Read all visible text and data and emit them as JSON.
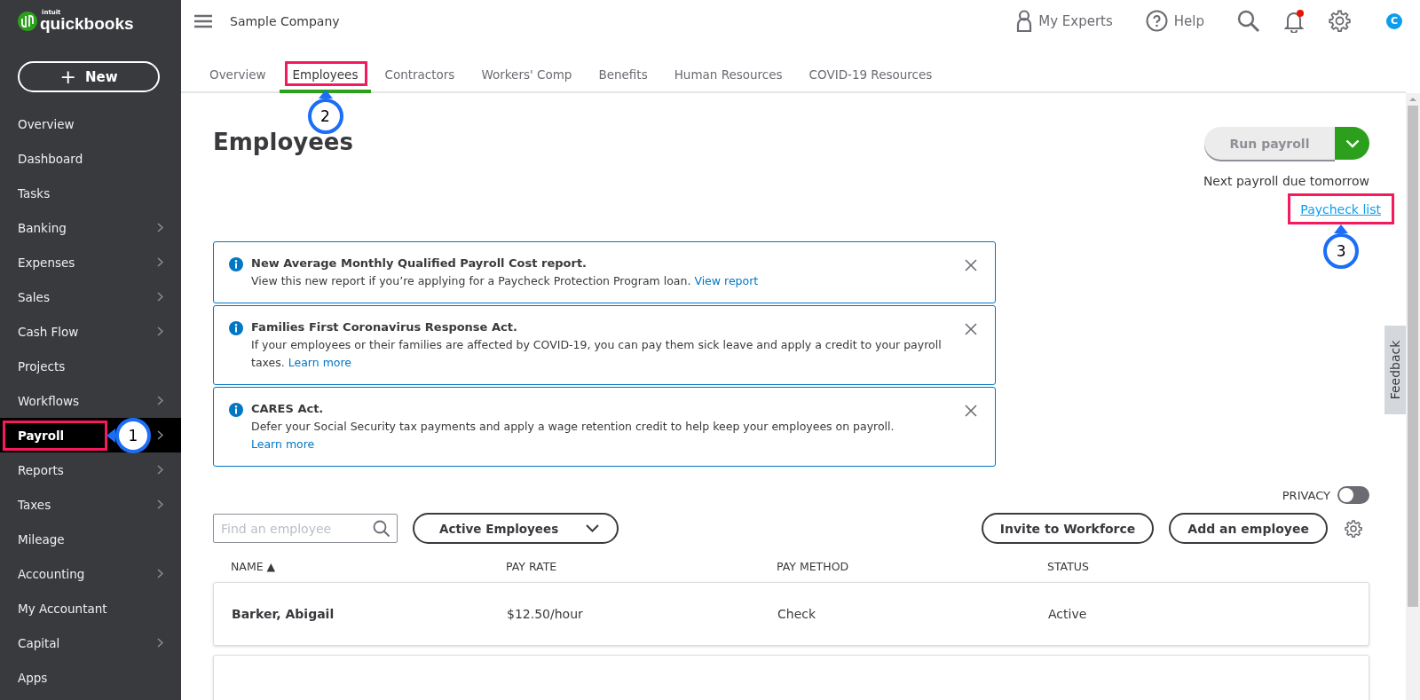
{
  "brand": {
    "maker": "intuit",
    "name": "quickbooks"
  },
  "new_button": {
    "icon": "+",
    "label": "New"
  },
  "sidebar": {
    "items": [
      {
        "label": "Overview",
        "submenu": false,
        "selected": false
      },
      {
        "label": "Dashboard",
        "submenu": false,
        "selected": false
      },
      {
        "label": "Tasks",
        "submenu": false,
        "selected": false
      },
      {
        "label": "Banking",
        "submenu": true,
        "selected": false
      },
      {
        "label": "Expenses",
        "submenu": true,
        "selected": false
      },
      {
        "label": "Sales",
        "submenu": true,
        "selected": false
      },
      {
        "label": "Cash Flow",
        "submenu": true,
        "selected": false
      },
      {
        "label": "Projects",
        "submenu": false,
        "selected": false
      },
      {
        "label": "Workflows",
        "submenu": true,
        "selected": false
      },
      {
        "label": "Payroll",
        "submenu": true,
        "selected": true,
        "callout": "1"
      },
      {
        "label": "Reports",
        "submenu": true,
        "selected": false
      },
      {
        "label": "Taxes",
        "submenu": true,
        "selected": false
      },
      {
        "label": "Mileage",
        "submenu": false,
        "selected": false
      },
      {
        "label": "Accounting",
        "submenu": true,
        "selected": false
      },
      {
        "label": "My Accountant",
        "submenu": false,
        "selected": false
      },
      {
        "label": "Capital",
        "submenu": true,
        "selected": false
      },
      {
        "label": "Apps",
        "submenu": false,
        "selected": false
      }
    ]
  },
  "topbar": {
    "company": "Sample Company",
    "experts": "My Experts",
    "help": "Help",
    "notification_dot": true,
    "avatar": "C"
  },
  "tabs": [
    {
      "label": "Overview",
      "selected": false
    },
    {
      "label": "Employees",
      "selected": true,
      "callout": "2"
    },
    {
      "label": "Contractors",
      "selected": false
    },
    {
      "label": "Workers' Comp",
      "selected": false
    },
    {
      "label": "Benefits",
      "selected": false
    },
    {
      "label": "Human Resources",
      "selected": false
    },
    {
      "label": "COVID-19 Resources",
      "selected": false
    }
  ],
  "page": {
    "title": "Employees",
    "run_payroll": {
      "label": "Run payroll",
      "disabled": true
    },
    "next_payroll": "Next payroll due tomorrow",
    "paycheck_link": {
      "label": "Paycheck list",
      "callout": "3"
    }
  },
  "notices": [
    {
      "title": "New Average Monthly Qualified Payroll Cost report.",
      "body": "View this new report if you’re applying for a Paycheck Protection Program loan.",
      "link": "View report"
    },
    {
      "title": "Families First Coronavirus Response Act.",
      "body": "If your employees or their families are affected by COVID-19, you can pay them sick leave and apply a credit to your payroll taxes.",
      "link": "Learn more"
    },
    {
      "title": "CARES Act.",
      "body": "Defer your Social Security tax payments and apply a wage retention credit to help keep your employees on payroll.",
      "link": "Learn more"
    }
  ],
  "privacy": {
    "label": "PRIVACY",
    "on": false
  },
  "toolbar": {
    "search_placeholder": "Find an employee",
    "filter": "Active Employees",
    "invite": "Invite to Workforce",
    "add": "Add an employee"
  },
  "table": {
    "columns": [
      {
        "label": "NAME",
        "sort_indicator": "▲"
      },
      {
        "label": "PAY RATE"
      },
      {
        "label": "PAY METHOD"
      },
      {
        "label": "STATUS"
      }
    ],
    "rows": [
      {
        "kind": "full",
        "cells": [
          "Barker, Abigail",
          "$12.50/hour",
          "Check",
          "Active"
        ]
      },
      {
        "kind": "clipped"
      }
    ]
  },
  "feedback": "Feedback"
}
